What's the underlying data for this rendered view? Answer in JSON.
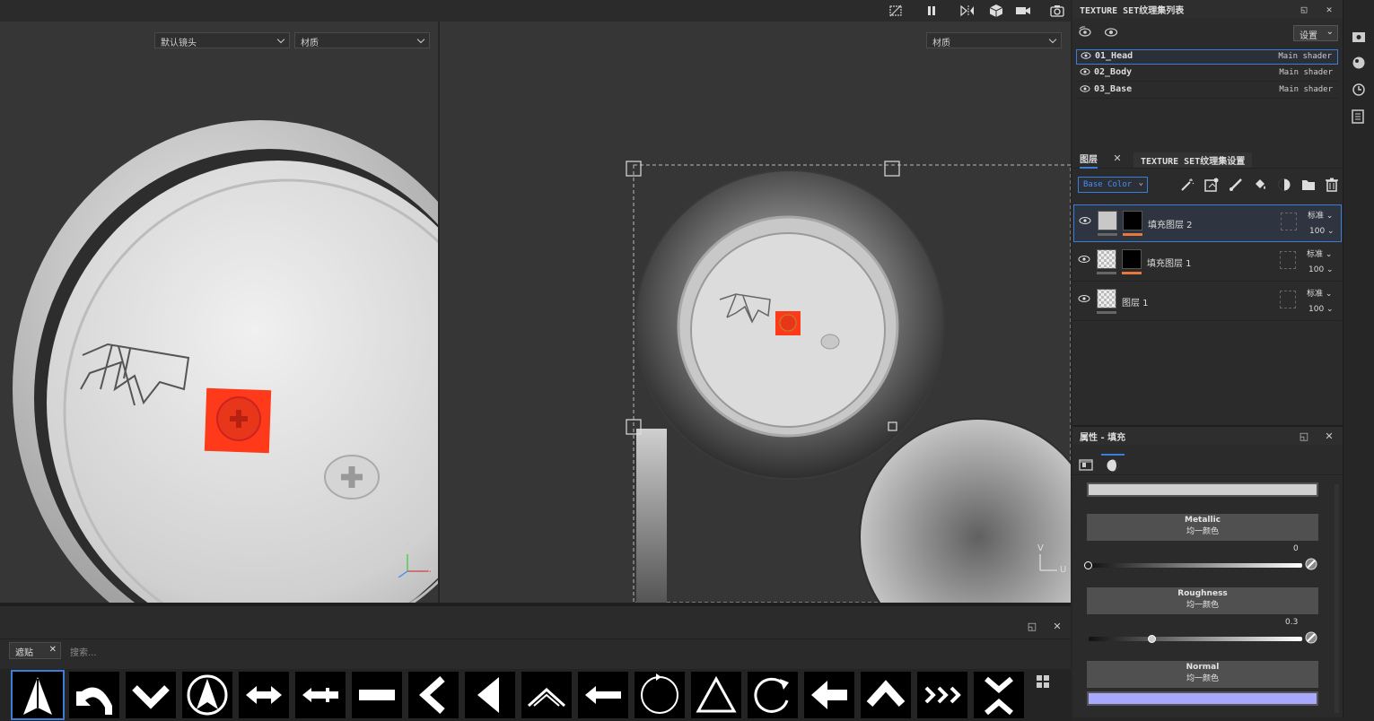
{
  "viewport3d": {
    "camera_select": "默认镜头",
    "material_select": "材质"
  },
  "viewport2d": {
    "material_select": "材质"
  },
  "texture_set_list": {
    "title": "TEXTURE SET纹理集列表",
    "settings_label": "设置",
    "items": [
      {
        "name": "01_Head",
        "shader": "Main shader",
        "selected": true
      },
      {
        "name": "02_Body",
        "shader": "Main shader",
        "selected": false
      },
      {
        "name": "03_Base",
        "shader": "Main shader",
        "selected": false
      }
    ]
  },
  "layers_panel": {
    "tab_layers": "图层",
    "tab_texture_set_settings": "TEXTURE SET纹理集设置",
    "channel_select": "Base Color",
    "layers": [
      {
        "name": "填充图层 2",
        "blend": "标准",
        "opacity": "100",
        "selected": true
      },
      {
        "name": "填充图层 1",
        "blend": "标准",
        "opacity": "100",
        "selected": false
      },
      {
        "name": "图层 1",
        "blend": "标准",
        "opacity": "100",
        "selected": false
      }
    ]
  },
  "properties_panel": {
    "title": "属性 - 填充",
    "metallic": {
      "label": "Metallic",
      "sub": "均一颜色",
      "value": "0",
      "fraction": 0
    },
    "roughness": {
      "label": "Roughness",
      "sub": "均一颜色",
      "value": "0.3",
      "fraction": 0.3
    },
    "normal": {
      "label": "Normal",
      "sub": "均一颜色"
    }
  },
  "shelf": {
    "tab_label": "遮贴",
    "search_placeholder": "搜索...",
    "stencil_icons": [
      "arrow-up-icon",
      "arrow-curve-left-icon",
      "chevron-down-icon",
      "compass-arrow-icon",
      "arrow-left-right-icon",
      "arrow-double-left-icon",
      "bar-icon",
      "chevron-left-icon",
      "triangle-left-icon",
      "chevron-up-double-icon",
      "arrow-left-icon",
      "circle-arrows-icon",
      "triangle-icon",
      "circle-arrow-icon",
      "arrow-left-bold-icon",
      "chevron-up-icon",
      "chevrons-right-icon",
      "chevrons-vertical-icon"
    ]
  },
  "axes": {
    "x": "X",
    "y": "Y",
    "v": "V",
    "u": "U"
  },
  "colors": {
    "accent": "#3b7ed8",
    "orange": "#e8783a",
    "stamp": "#ff3a1a",
    "normal": "#a8a8ff"
  }
}
